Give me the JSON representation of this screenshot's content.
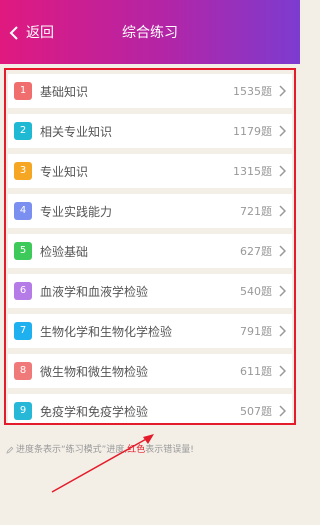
{
  "header": {
    "back_label": "返回",
    "title": "综合练习",
    "gradient_colors": [
      "#e0197f",
      "#7d3bd0"
    ]
  },
  "list": {
    "items": [
      {
        "num": "1",
        "label": "基础知识",
        "count": "1535题",
        "color": "#f06e6e"
      },
      {
        "num": "2",
        "label": "相关专业知识",
        "count": "1179题",
        "color": "#1fb9d4"
      },
      {
        "num": "3",
        "label": "专业知识",
        "count": "1315题",
        "color": "#f5a623"
      },
      {
        "num": "4",
        "label": "专业实践能力",
        "count": "721题",
        "color": "#7b8ff0"
      },
      {
        "num": "5",
        "label": "检验基础",
        "count": "627题",
        "color": "#3ec95b"
      },
      {
        "num": "6",
        "label": "血液学和血液学检验",
        "count": "540题",
        "color": "#b57be6"
      },
      {
        "num": "7",
        "label": "生物化学和生物化学检验",
        "count": "791题",
        "color": "#1fb0f0"
      },
      {
        "num": "8",
        "label": "微生物和微生物检验",
        "count": "611题",
        "color": "#f07a7a"
      },
      {
        "num": "9",
        "label": "免疫学和免疫学检验",
        "count": "507题",
        "color": "#27b8d8"
      }
    ],
    "highlight_color": "#e41b2a"
  },
  "note": {
    "part1": "进度条表示“练习模式”进度,",
    "part2": "红色",
    "part3": "表示错误量!"
  },
  "icons": {
    "back": "chevron-left-icon",
    "row": "chevron-right-icon",
    "note": "pencil-icon"
  }
}
